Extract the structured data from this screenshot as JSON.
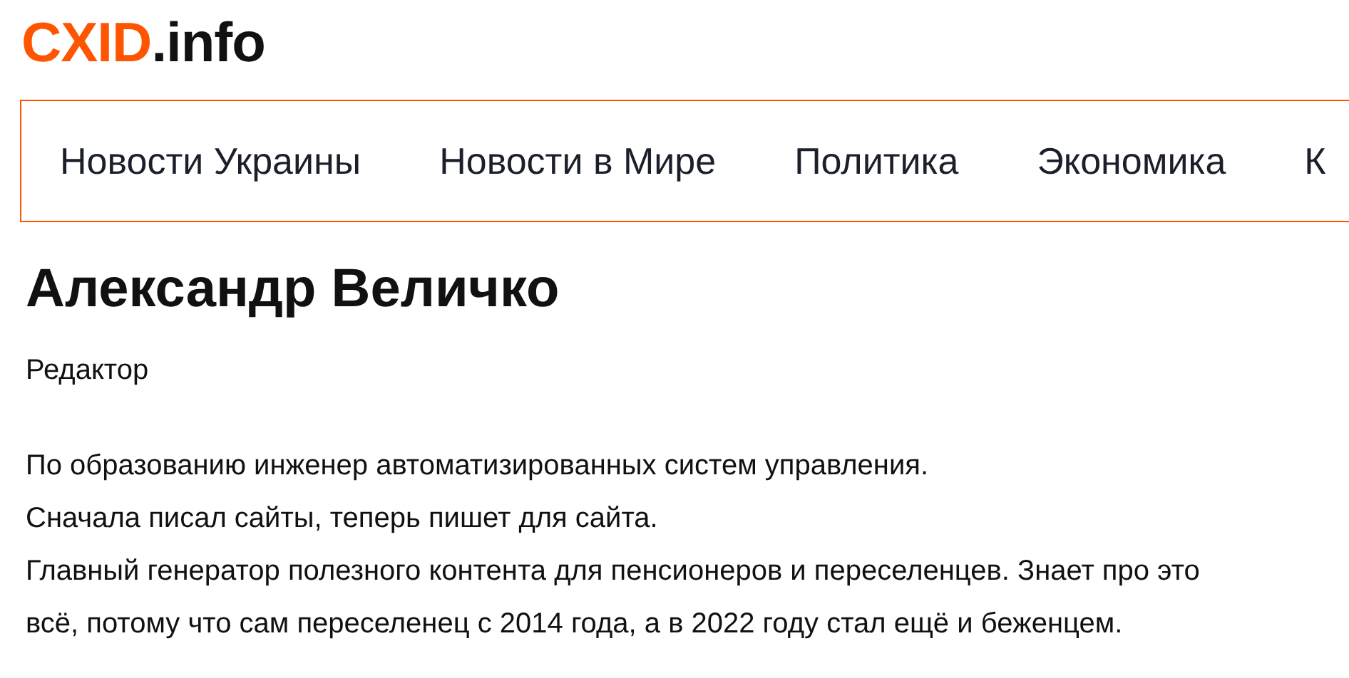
{
  "logo": {
    "brand": "CXID",
    "domain": ".info"
  },
  "nav": [
    {
      "label": "Новости Украины"
    },
    {
      "label": "Новости в Мире"
    },
    {
      "label": "Политика"
    },
    {
      "label": "Экономика"
    },
    {
      "label": "К"
    }
  ],
  "author": {
    "name": "Александр Величко",
    "role": "Редактор",
    "bio": [
      "По образованию инженер автоматизированных систем управления.",
      "Сначала писал сайты, теперь пишет для сайта.",
      "Главный генератор полезного контента для пенсионеров и переселенцев. Знает про это",
      "всё, потому что сам переселенец с 2014 года, а в 2022 году стал ещё и беженцем."
    ]
  }
}
